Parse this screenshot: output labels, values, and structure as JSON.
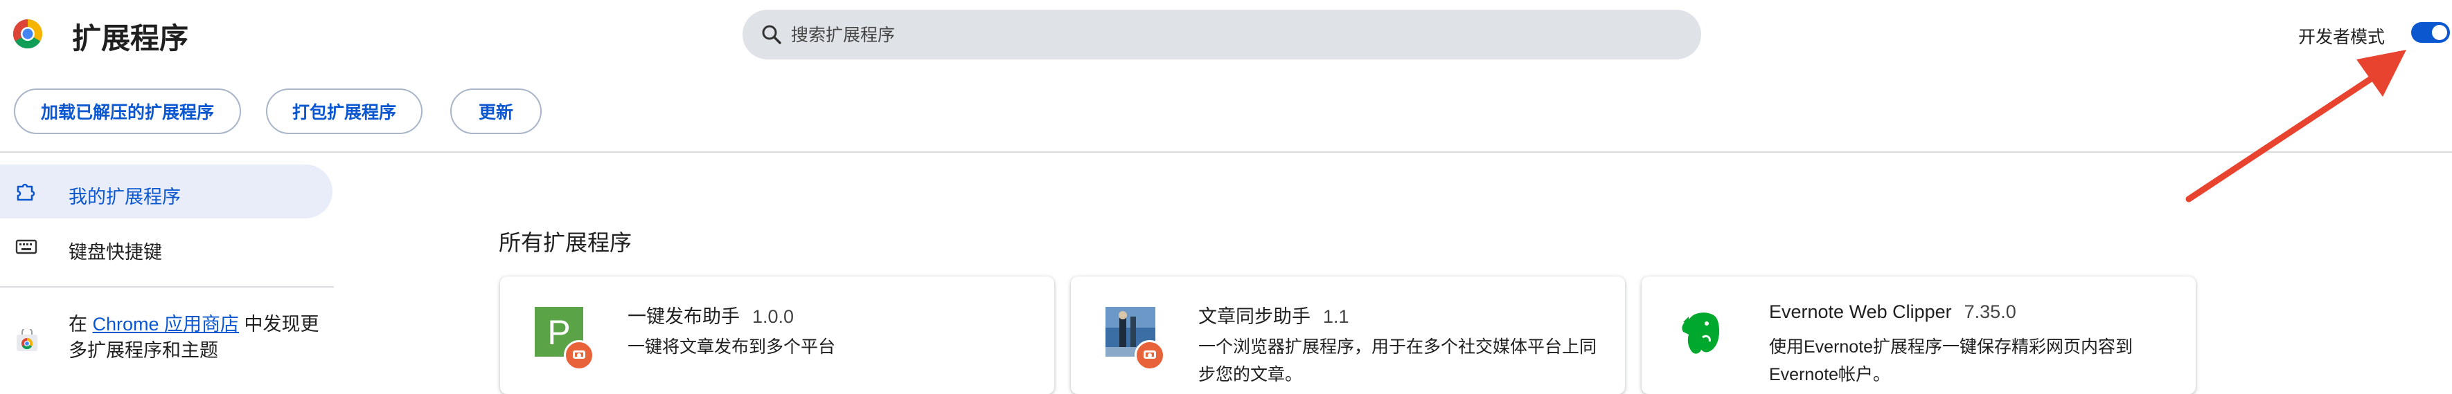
{
  "header": {
    "title": "扩展程序",
    "search_placeholder": "搜索扩展程序",
    "dev_mode_label": "开发者模式",
    "dev_mode_on": true
  },
  "toolbar": {
    "load_unpacked": "加载已解压的扩展程序",
    "pack": "打包扩展程序",
    "update": "更新"
  },
  "sidebar": {
    "items": [
      {
        "label": "我的扩展程序",
        "icon": "puzzle-icon",
        "active": true
      },
      {
        "label": "键盘快捷键",
        "icon": "keyboard-icon",
        "active": false
      }
    ],
    "store_prefix": "在 ",
    "store_link": "Chrome 应用商店",
    "store_suffix": " 中发现更多扩展程序和主题"
  },
  "main": {
    "section_title": "所有扩展程序",
    "extensions": [
      {
        "name": "一键发布助手",
        "version": "1.0.0",
        "description": "一键将文章发布到多个平台",
        "icon": "green-p-icon"
      },
      {
        "name": "文章同步助手",
        "version": "1.1",
        "description": "一个浏览器扩展程序，用于在多个社交媒体平台上同步您的文章。",
        "icon": "photo-icon"
      },
      {
        "name": "Evernote Web Clipper",
        "version": "7.35.0",
        "description": "使用Evernote扩展程序一键保存精彩网页内容到Evernote帐户。",
        "icon": "elephant-icon"
      }
    ]
  },
  "colors": {
    "accent": "#0b57d0",
    "annotation_arrow": "#e8432f"
  }
}
